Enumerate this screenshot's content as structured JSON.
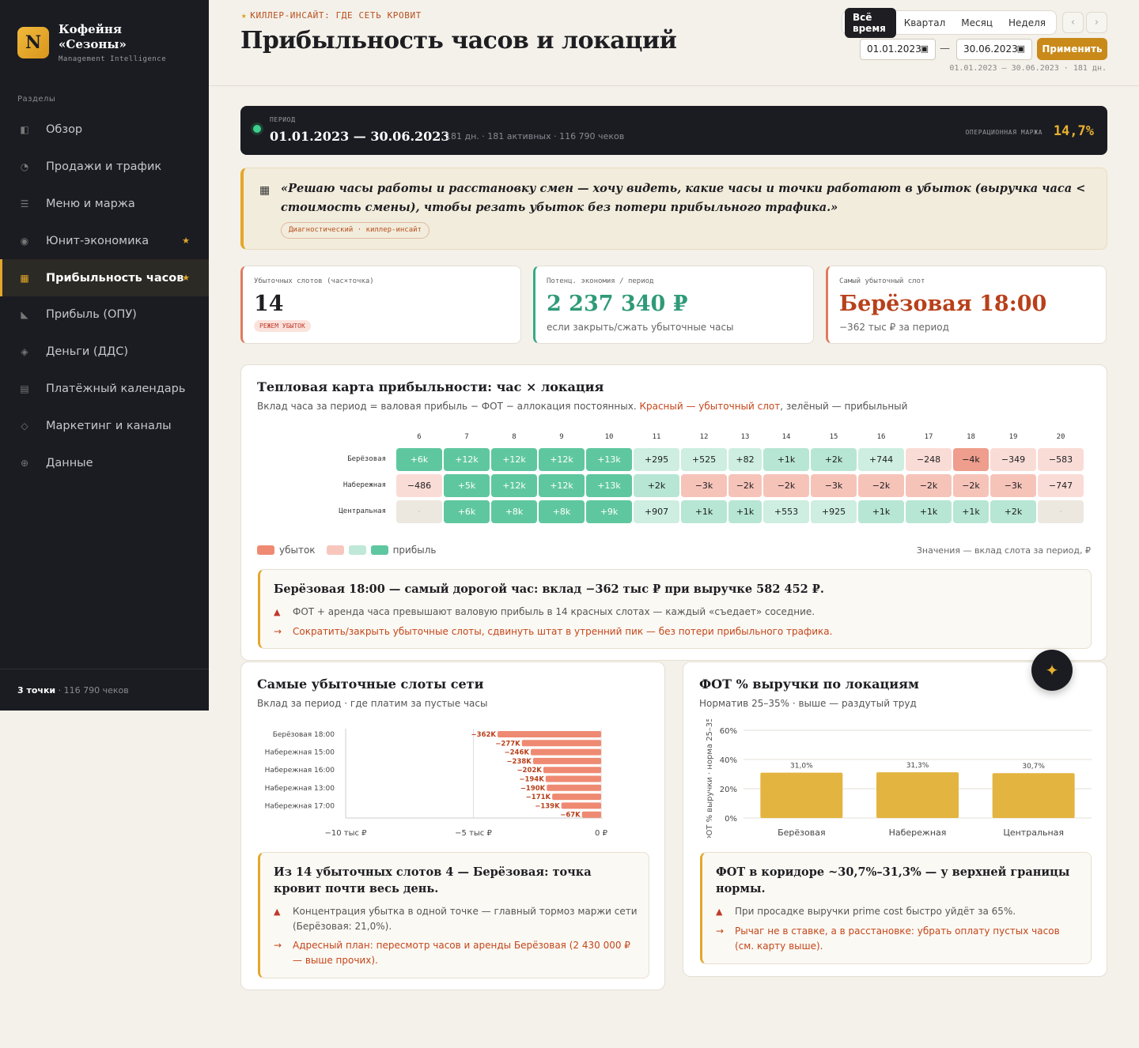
{
  "sidebar": {
    "logo_letter": "N",
    "brand_line1": "Кофейня",
    "brand_line2": "«Сезоны»",
    "brand_sub": "Management Intelligence",
    "section_label": "Разделы",
    "items": [
      {
        "label": "Обзор",
        "icon": "◧",
        "star": ""
      },
      {
        "label": "Продажи и трафик",
        "icon": "◔",
        "star": ""
      },
      {
        "label": "Меню и маржа",
        "icon": "☰",
        "star": ""
      },
      {
        "label": "Юнит-экономика",
        "icon": "◉",
        "star": "★"
      },
      {
        "label": "Прибыльность часов",
        "icon": "▦",
        "star": "★"
      },
      {
        "label": "Прибыль (ОПУ)",
        "icon": "◣",
        "star": ""
      },
      {
        "label": "Деньги (ДДС)",
        "icon": "◈",
        "star": ""
      },
      {
        "label": "Платёжный календарь",
        "icon": "▤",
        "star": ""
      },
      {
        "label": "Маркетинг и каналы",
        "icon": "◇",
        "star": ""
      },
      {
        "label": "Данные",
        "icon": "⊕",
        "star": ""
      }
    ],
    "footer_bold": "3 точки",
    "footer_rest": " · 116 790 чеков"
  },
  "header": {
    "kicker": "КИЛЛЕР-ИНСАЙТ: ГДЕ СЕТЬ КРОВИТ",
    "title": "Прибыльность часов и локаций",
    "periods": [
      "Всё время",
      "Квартал",
      "Месяц",
      "Неделя"
    ],
    "prev": "‹",
    "next": "›",
    "date_from": "01.01.2023",
    "date_to": "30.06.2023",
    "dash": "—",
    "apply": "Применить",
    "range_note": "01.01.2023 — 30.06.2023 · 181 дн."
  },
  "period": {
    "label": "ПЕРИОД",
    "value": "01.01.2023 — 30.06.2023",
    "meta": "181 дн. · 181 активных · 116 790 чеков",
    "margin_label": "ОПЕРАЦИОННАЯ МАРЖА",
    "margin_value": "14,7%"
  },
  "quote": {
    "text": "«Решаю часы работы и расстановку смен — хочу видеть, какие часы и точки работают в убыток (выручка часа < стоимость смены), чтобы резать убыток без потери прибыльного трафика.»",
    "tag": "Диагностический · киллер-инсайт"
  },
  "kpis": [
    {
      "label": "Убыточных слотов (час×точка)",
      "value": "14",
      "badge": "РЕЖЕМ УБЫТОК",
      "sub": ""
    },
    {
      "label": "Потенц. экономия / период",
      "value": "2 237 340 ₽",
      "badge": "",
      "sub": "если закрыть/сжать убыточные часы"
    },
    {
      "label": "Самый убыточный слот",
      "value": "Берёзовая 18:00",
      "badge": "",
      "sub": "−362 тыс ₽ за период"
    }
  ],
  "heatmap": {
    "title": "Тепловая карта прибыльности: час × локация",
    "subtitle_a": "Вклад часа за период = валовая прибыль − ФОТ − аллокация постоянных. ",
    "subtitle_red": "Красный — убыточный слот",
    "subtitle_b": ", зелёный — прибыльный",
    "hours": [
      "6",
      "7",
      "8",
      "9",
      "10",
      "11",
      "12",
      "13",
      "14",
      "15",
      "16",
      "17",
      "18",
      "19",
      "20"
    ],
    "rows": [
      {
        "location": "Берёзовая",
        "cells": [
          {
            "t": "+6k",
            "v": 6000
          },
          {
            "t": "+12k",
            "v": 12000
          },
          {
            "t": "+12k",
            "v": 12000
          },
          {
            "t": "+12k",
            "v": 12000
          },
          {
            "t": "+13k",
            "v": 13000
          },
          {
            "t": "+295",
            "v": 295
          },
          {
            "t": "+525",
            "v": 525
          },
          {
            "t": "+82",
            "v": 82
          },
          {
            "t": "+1k",
            "v": 1000
          },
          {
            "t": "+2k",
            "v": 2000
          },
          {
            "t": "+744",
            "v": 744
          },
          {
            "t": "−248",
            "v": -248
          },
          {
            "t": "−4k",
            "v": -4000
          },
          {
            "t": "−349",
            "v": -349
          },
          {
            "t": "−583",
            "v": -583
          }
        ]
      },
      {
        "location": "Набережная",
        "cells": [
          {
            "t": "−486",
            "v": -486
          },
          {
            "t": "+5k",
            "v": 5000
          },
          {
            "t": "+12k",
            "v": 12000
          },
          {
            "t": "+12k",
            "v": 12000
          },
          {
            "t": "+13k",
            "v": 13000
          },
          {
            "t": "+2k",
            "v": 2000
          },
          {
            "t": "−3k",
            "v": -3000
          },
          {
            "t": "−2k",
            "v": -2000
          },
          {
            "t": "−2k",
            "v": -2000
          },
          {
            "t": "−3k",
            "v": -3000
          },
          {
            "t": "−2k",
            "v": -2000
          },
          {
            "t": "−2k",
            "v": -2000
          },
          {
            "t": "−2k",
            "v": -2000
          },
          {
            "t": "−3k",
            "v": -3000
          },
          {
            "t": "−747",
            "v": -747
          }
        ]
      },
      {
        "location": "Центральная",
        "cells": [
          {
            "t": "·",
            "v": null
          },
          {
            "t": "+6k",
            "v": 6000
          },
          {
            "t": "+8k",
            "v": 8000
          },
          {
            "t": "+8k",
            "v": 8000
          },
          {
            "t": "+9k",
            "v": 9000
          },
          {
            "t": "+907",
            "v": 907
          },
          {
            "t": "+1k",
            "v": 1000
          },
          {
            "t": "+1k",
            "v": 1000
          },
          {
            "t": "+553",
            "v": 553
          },
          {
            "t": "+925",
            "v": 925
          },
          {
            "t": "+1k",
            "v": 1000
          },
          {
            "t": "+1k",
            "v": 1000
          },
          {
            "t": "+1k",
            "v": 1000
          },
          {
            "t": "+2k",
            "v": 2000
          },
          {
            "t": "·",
            "v": null
          }
        ]
      }
    ],
    "legend_loss": "убыток",
    "legend_profit": "прибыль",
    "note": "Значения — вклад слота за период, ₽",
    "insight_title": "Берёзовая 18:00 — самый дорогой час: вклад −362 тыс ₽ при выручке 582 452 ₽.",
    "insight_warn": "ФОТ + аренда часа превышают валовую прибыль в 14 красных слотах — каждый «съедает» соседние.",
    "insight_action": "Сократить/закрыть убыточные слоты, сдвинуть штат в утренний пик — без потери прибыльного трафика."
  },
  "loss_slots": {
    "title": "Самые убыточные слоты сети",
    "subtitle": "Вклад за период · где платим за пустые часы",
    "insight_title": "Из 14 убыточных слотов 4 — Берёзовая: точка кровит почти весь день.",
    "insight_warn": "Концентрация убытка в одной точке — главный тормоз маржи сети (Берёзовая: 21,0%).",
    "insight_action": "Адресный план: пересмотр часов и аренды Берёзовая (2 430 000 ₽ — выше прочих)."
  },
  "fot": {
    "title": "ФОТ % выручки по локациям",
    "subtitle": "Норматив 25–35% · выше — раздутый труд",
    "insight_title": "ФОТ в коридоре ~30,7%–31,3% — у верхней границы нормы.",
    "insight_warn": "При просадке выручки prime cost быстро уйдёт за 65%.",
    "insight_action": "Рычаг не в ставке, а в расстановке: убрать оплату пустых часов (см. карту выше)."
  },
  "chart_data": [
    {
      "type": "bar",
      "orientation": "horizontal",
      "title": "Самые убыточные слоты сети",
      "categories": [
        "Берёзовая 18:00",
        "",
        "Набережная 15:00",
        "",
        "Набережная 16:00",
        "",
        "Набережная 13:00",
        "",
        "Набережная 17:00",
        ""
      ],
      "values": [
        -362,
        -277,
        -246,
        -238,
        -202,
        -194,
        -190,
        -171,
        -139,
        -67
      ],
      "value_labels": [
        "−362K",
        "−277K",
        "−246K",
        "−238K",
        "−202K",
        "−194K",
        "−190K",
        "−171K",
        "−139K",
        "−67K"
      ],
      "x_ticks": [
        "−10 тыс ₽",
        "−5 тыс ₽",
        "0 ₽"
      ],
      "xlim": [
        -10,
        0
      ],
      "color": "#ef8a72",
      "grid": false
    },
    {
      "type": "bar",
      "title": "ФОТ % выручки по локациям",
      "categories": [
        "Берёзовая",
        "Набережная",
        "Центральная"
      ],
      "values": [
        31.0,
        31.3,
        30.7
      ],
      "value_labels": [
        "31,0%",
        "31,3%",
        "30,7%"
      ],
      "ylabel": "ФОТ % выручки · норма 25–35%",
      "y_ticks": [
        "0%",
        "20%",
        "40%",
        "60%"
      ],
      "ylim": [
        0,
        60
      ],
      "color": "#e3b440",
      "grid": true
    }
  ],
  "fab_icon": "✦"
}
